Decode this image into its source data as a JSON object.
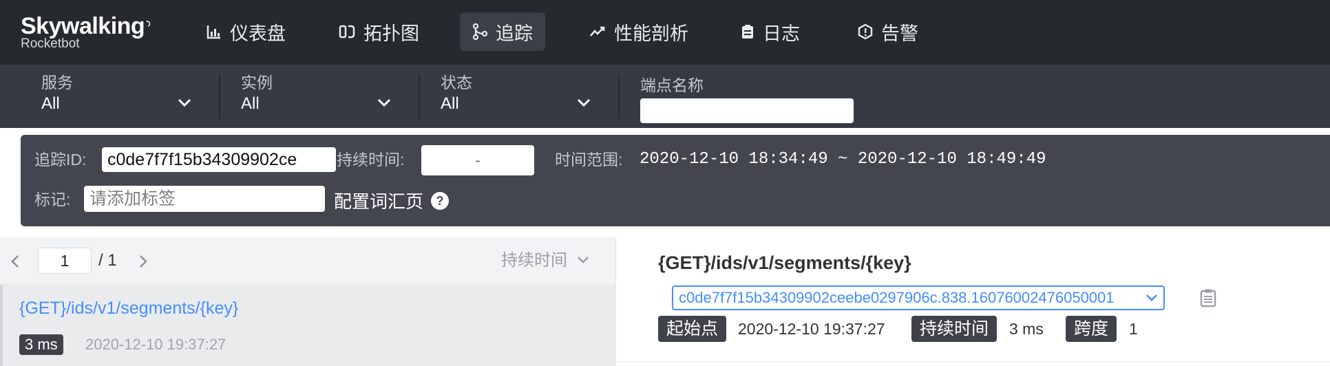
{
  "app": {
    "logo_main": "Skywalking",
    "logo_sub": "Rocketbot"
  },
  "nav": {
    "items": [
      {
        "label": "仪表盘",
        "icon": "dashboard-chart-icon"
      },
      {
        "label": "拓扑图",
        "icon": "topology-icon"
      },
      {
        "label": "追踪",
        "icon": "trace-icon",
        "active": true
      },
      {
        "label": "性能剖析",
        "icon": "profile-trend-icon"
      },
      {
        "label": "日志",
        "icon": "log-clipboard-icon"
      },
      {
        "label": "告警",
        "icon": "alarm-shield-icon"
      }
    ]
  },
  "filters": {
    "service": {
      "label": "服务",
      "value": "All"
    },
    "instance": {
      "label": "实例",
      "value": "All"
    },
    "status": {
      "label": "状态",
      "value": "All"
    },
    "endpoint": {
      "label": "端点名称",
      "value": ""
    }
  },
  "search": {
    "trace_id_label": "追踪ID:",
    "trace_id_value": "c0de7f7f15b34309902ce",
    "duration_label": "持续时间:",
    "duration_value": "-",
    "time_range_label": "时间范围:",
    "time_range_value": "2020-12-10 18:34:49 ~ 2020-12-10 18:49:49",
    "tags_label": "标记:",
    "tags_placeholder": "请添加标签",
    "config_link": "配置词汇页",
    "help": "?"
  },
  "list": {
    "page": "1",
    "total": "/ 1",
    "sort_label": "持续时间",
    "items": [
      {
        "title": "{GET}/ids/v1/segments/{key}",
        "duration": "3 ms",
        "time": "2020-12-10 19:37:27"
      }
    ]
  },
  "detail": {
    "title": "{GET}/ids/v1/segments/{key}",
    "trace_id": "c0de7f7f15b34309902ceebe0297906c.838.16076002476050001",
    "start_label": "起始点",
    "start_value": "2020-12-10 19:37:27",
    "duration_label": "持续时间",
    "duration_value": "3 ms",
    "span_label": "跨度",
    "span_value": "1"
  },
  "colors": {
    "topbar": "#252a2f",
    "filterbar": "#363a44",
    "searchpanel": "#43464f",
    "link_blue": "#448dfe",
    "tag_dark": "#3f4349"
  }
}
